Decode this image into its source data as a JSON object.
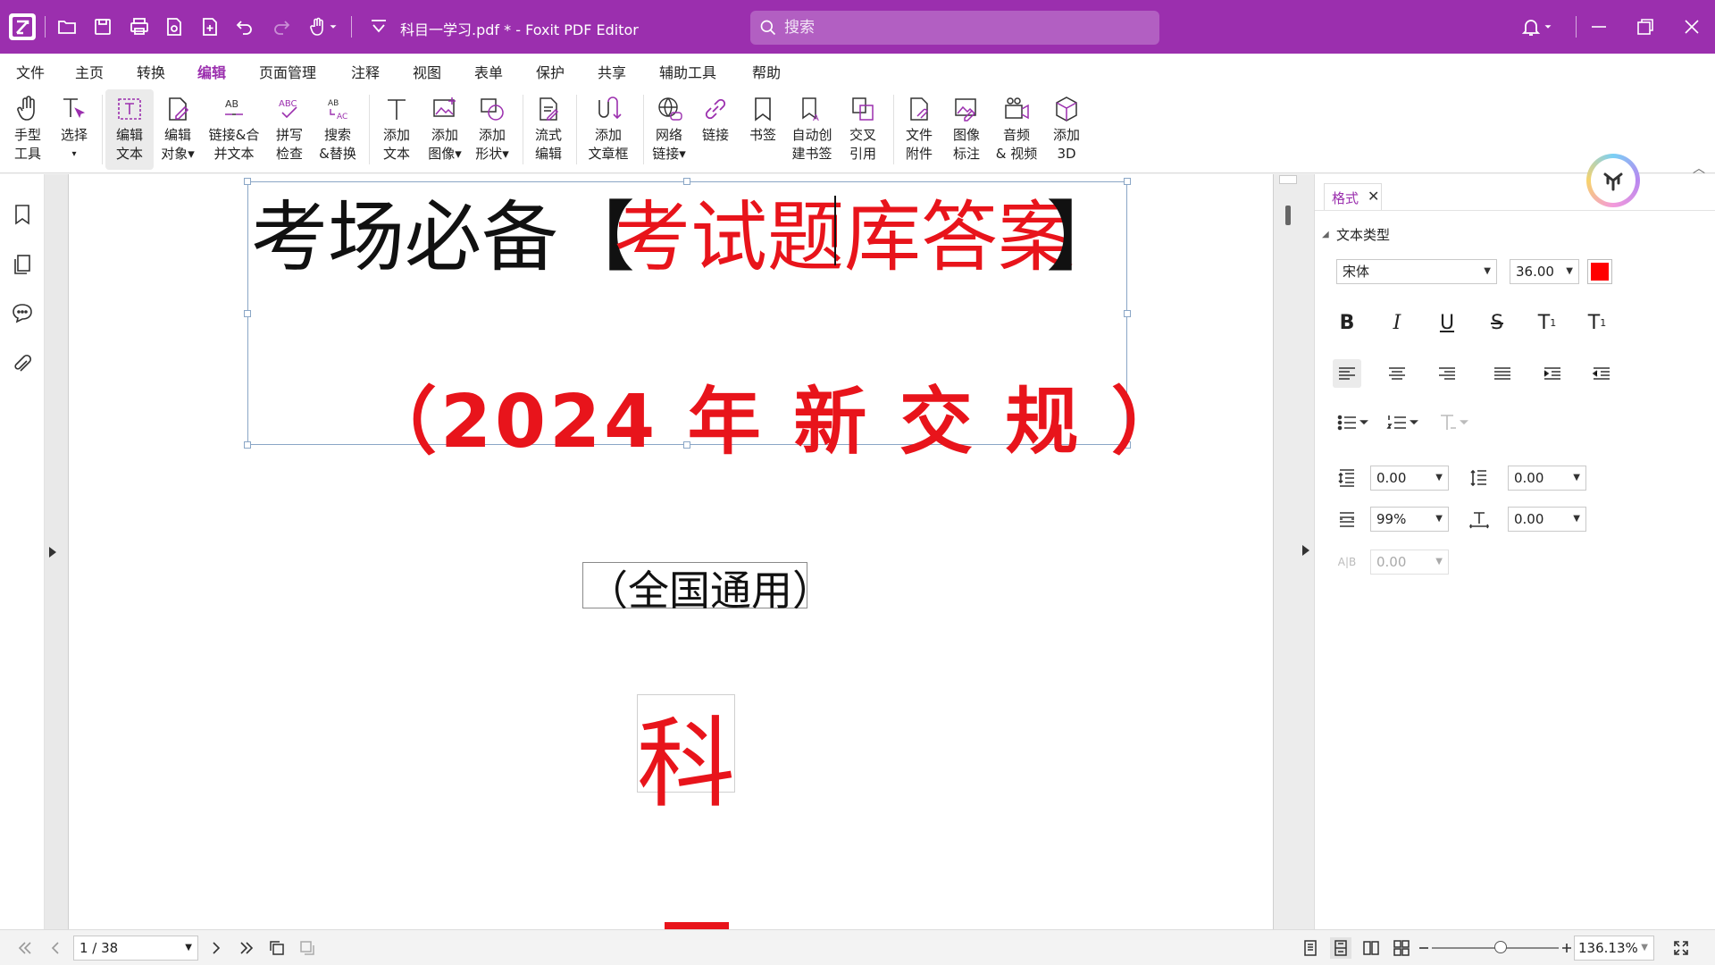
{
  "window": {
    "title": "科目一学习.pdf * - Foxit PDF Editor",
    "search_placeholder": "搜索"
  },
  "menu": {
    "items": [
      "文件",
      "主页",
      "转换",
      "编辑",
      "页面管理",
      "注释",
      "视图",
      "表单",
      "保护",
      "共享",
      "辅助工具",
      "帮助"
    ],
    "active": "编辑"
  },
  "ribbon": {
    "buttons": [
      {
        "label1": "手型",
        "label2": "工具",
        "icon": "hand-icon"
      },
      {
        "label1": "选择",
        "label2": "▾",
        "icon": "select-text-icon"
      },
      {
        "label1": "编辑",
        "label2": "文本",
        "icon": "edit-text-icon"
      },
      {
        "label1": "编辑",
        "label2": "对象▾",
        "icon": "edit-object-icon"
      },
      {
        "label1": "链接&合",
        "label2": "并文本",
        "icon": "link-merge-text-icon"
      },
      {
        "label1": "拼写",
        "label2": "检查",
        "icon": "spell-check-icon"
      },
      {
        "label1": "搜索",
        "label2": "&替换",
        "icon": "search-replace-icon"
      },
      {
        "label1": "添加",
        "label2": "文本",
        "icon": "add-text-icon"
      },
      {
        "label1": "添加",
        "label2": "图像▾",
        "icon": "add-image-icon"
      },
      {
        "label1": "添加",
        "label2": "形状▾",
        "icon": "add-shape-icon"
      },
      {
        "label1": "流式",
        "label2": "编辑",
        "icon": "reflow-edit-icon"
      },
      {
        "label1": "添加",
        "label2": "文章框",
        "icon": "article-box-icon"
      },
      {
        "label1": "网络",
        "label2": "链接▾",
        "icon": "web-link-icon"
      },
      {
        "label1": "链接",
        "label2": "",
        "icon": "link-icon"
      },
      {
        "label1": "书签",
        "label2": "",
        "icon": "bookmark-icon"
      },
      {
        "label1": "自动创",
        "label2": "建书签",
        "icon": "auto-bookmark-icon"
      },
      {
        "label1": "交叉",
        "label2": "引用",
        "icon": "cross-reference-icon"
      },
      {
        "label1": "文件",
        "label2": "附件",
        "icon": "file-attachment-icon"
      },
      {
        "label1": "图像",
        "label2": "标注",
        "icon": "image-annotation-icon"
      },
      {
        "label1": "音频",
        "label2": "& 视频",
        "icon": "audio-video-icon"
      },
      {
        "label1": "添加",
        "label2": "3D",
        "icon": "add-3d-icon"
      }
    ]
  },
  "document": {
    "line1_black_a": "考场必备【",
    "line1_red": "考试题库答案",
    "line1_black_b": "】",
    "line2": "（2024 年 新 交 规 ）",
    "subtitle": "（全国通用）",
    "subject_char": "科"
  },
  "format_panel": {
    "tab_label": "格式",
    "tab_close": "✕",
    "section_title": "文本类型",
    "font_name": "宋体",
    "font_size": "36.00",
    "font_color": "#ff0000",
    "line_spacing": "0.00",
    "paragraph_spacing": "0.00",
    "char_scale": "99%",
    "char_spacing": "0.00",
    "word_spacing": "0.00"
  },
  "statusbar": {
    "page": "1 / 38",
    "zoom": "136.13%"
  },
  "colors": {
    "brand": "#9b2fae",
    "doc_red": "#e8141b"
  }
}
